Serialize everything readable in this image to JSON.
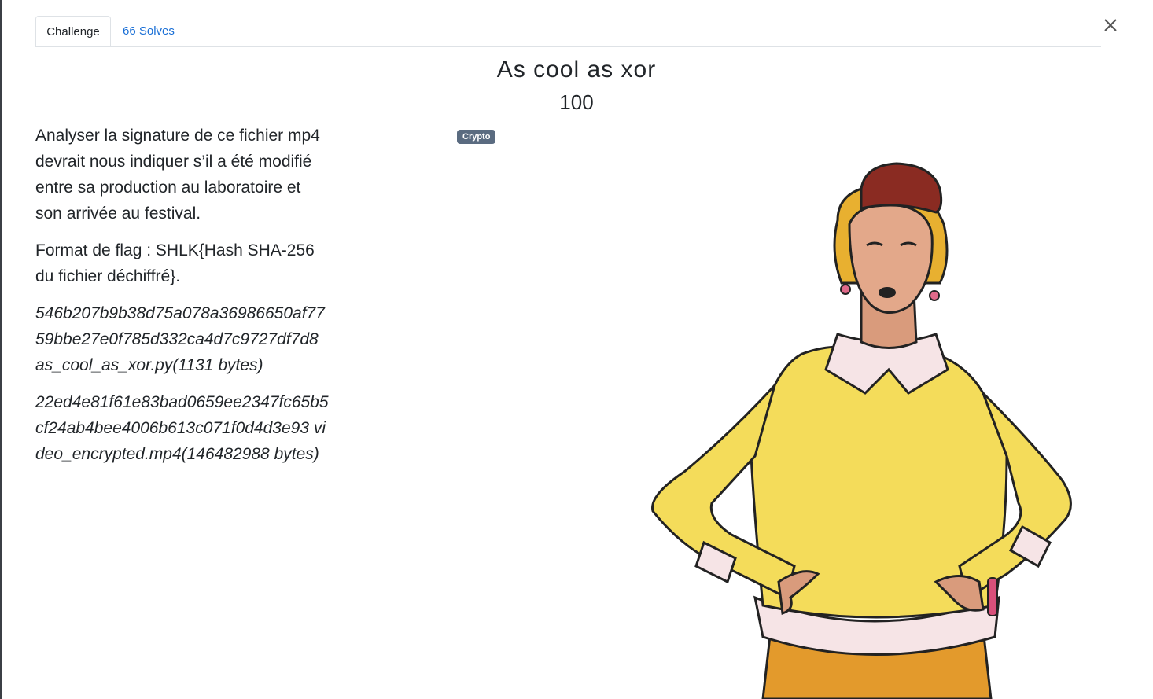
{
  "tabs": {
    "challenge_label": "Challenge",
    "solves_label": "66 Solves"
  },
  "challenge": {
    "title": "As cool as xor",
    "value": "100",
    "tag": "Crypto",
    "description": [
      "Analyser la signature de ce fichier mp4 devrait nous indiquer s’il a été modifié entre sa production au laboratoire et son arrivée au festival.",
      "Format de flag : SHLK{Hash SHA-256 du fichier déchiffré}."
    ],
    "hashes": [
      "546b207b9b38d75a078a36986650af7759bbe27e0f785d332ca4d7c9727df7d8 as_cool_as_xor.py(1131 bytes)",
      "22ed4e81f61e83bad0659ee2347fc65b5cf24ab4bee4006b613c071f0d4d3e93 video_encrypted.mp4(146482988 bytes)"
    ]
  },
  "icons": {
    "close": "close-icon"
  },
  "colors": {
    "link": "#1a6fd6",
    "tag_bg": "#5a6b80",
    "sweater": "#f4dc5a",
    "hat": "#8a2b22",
    "hair": "#e8b030"
  }
}
